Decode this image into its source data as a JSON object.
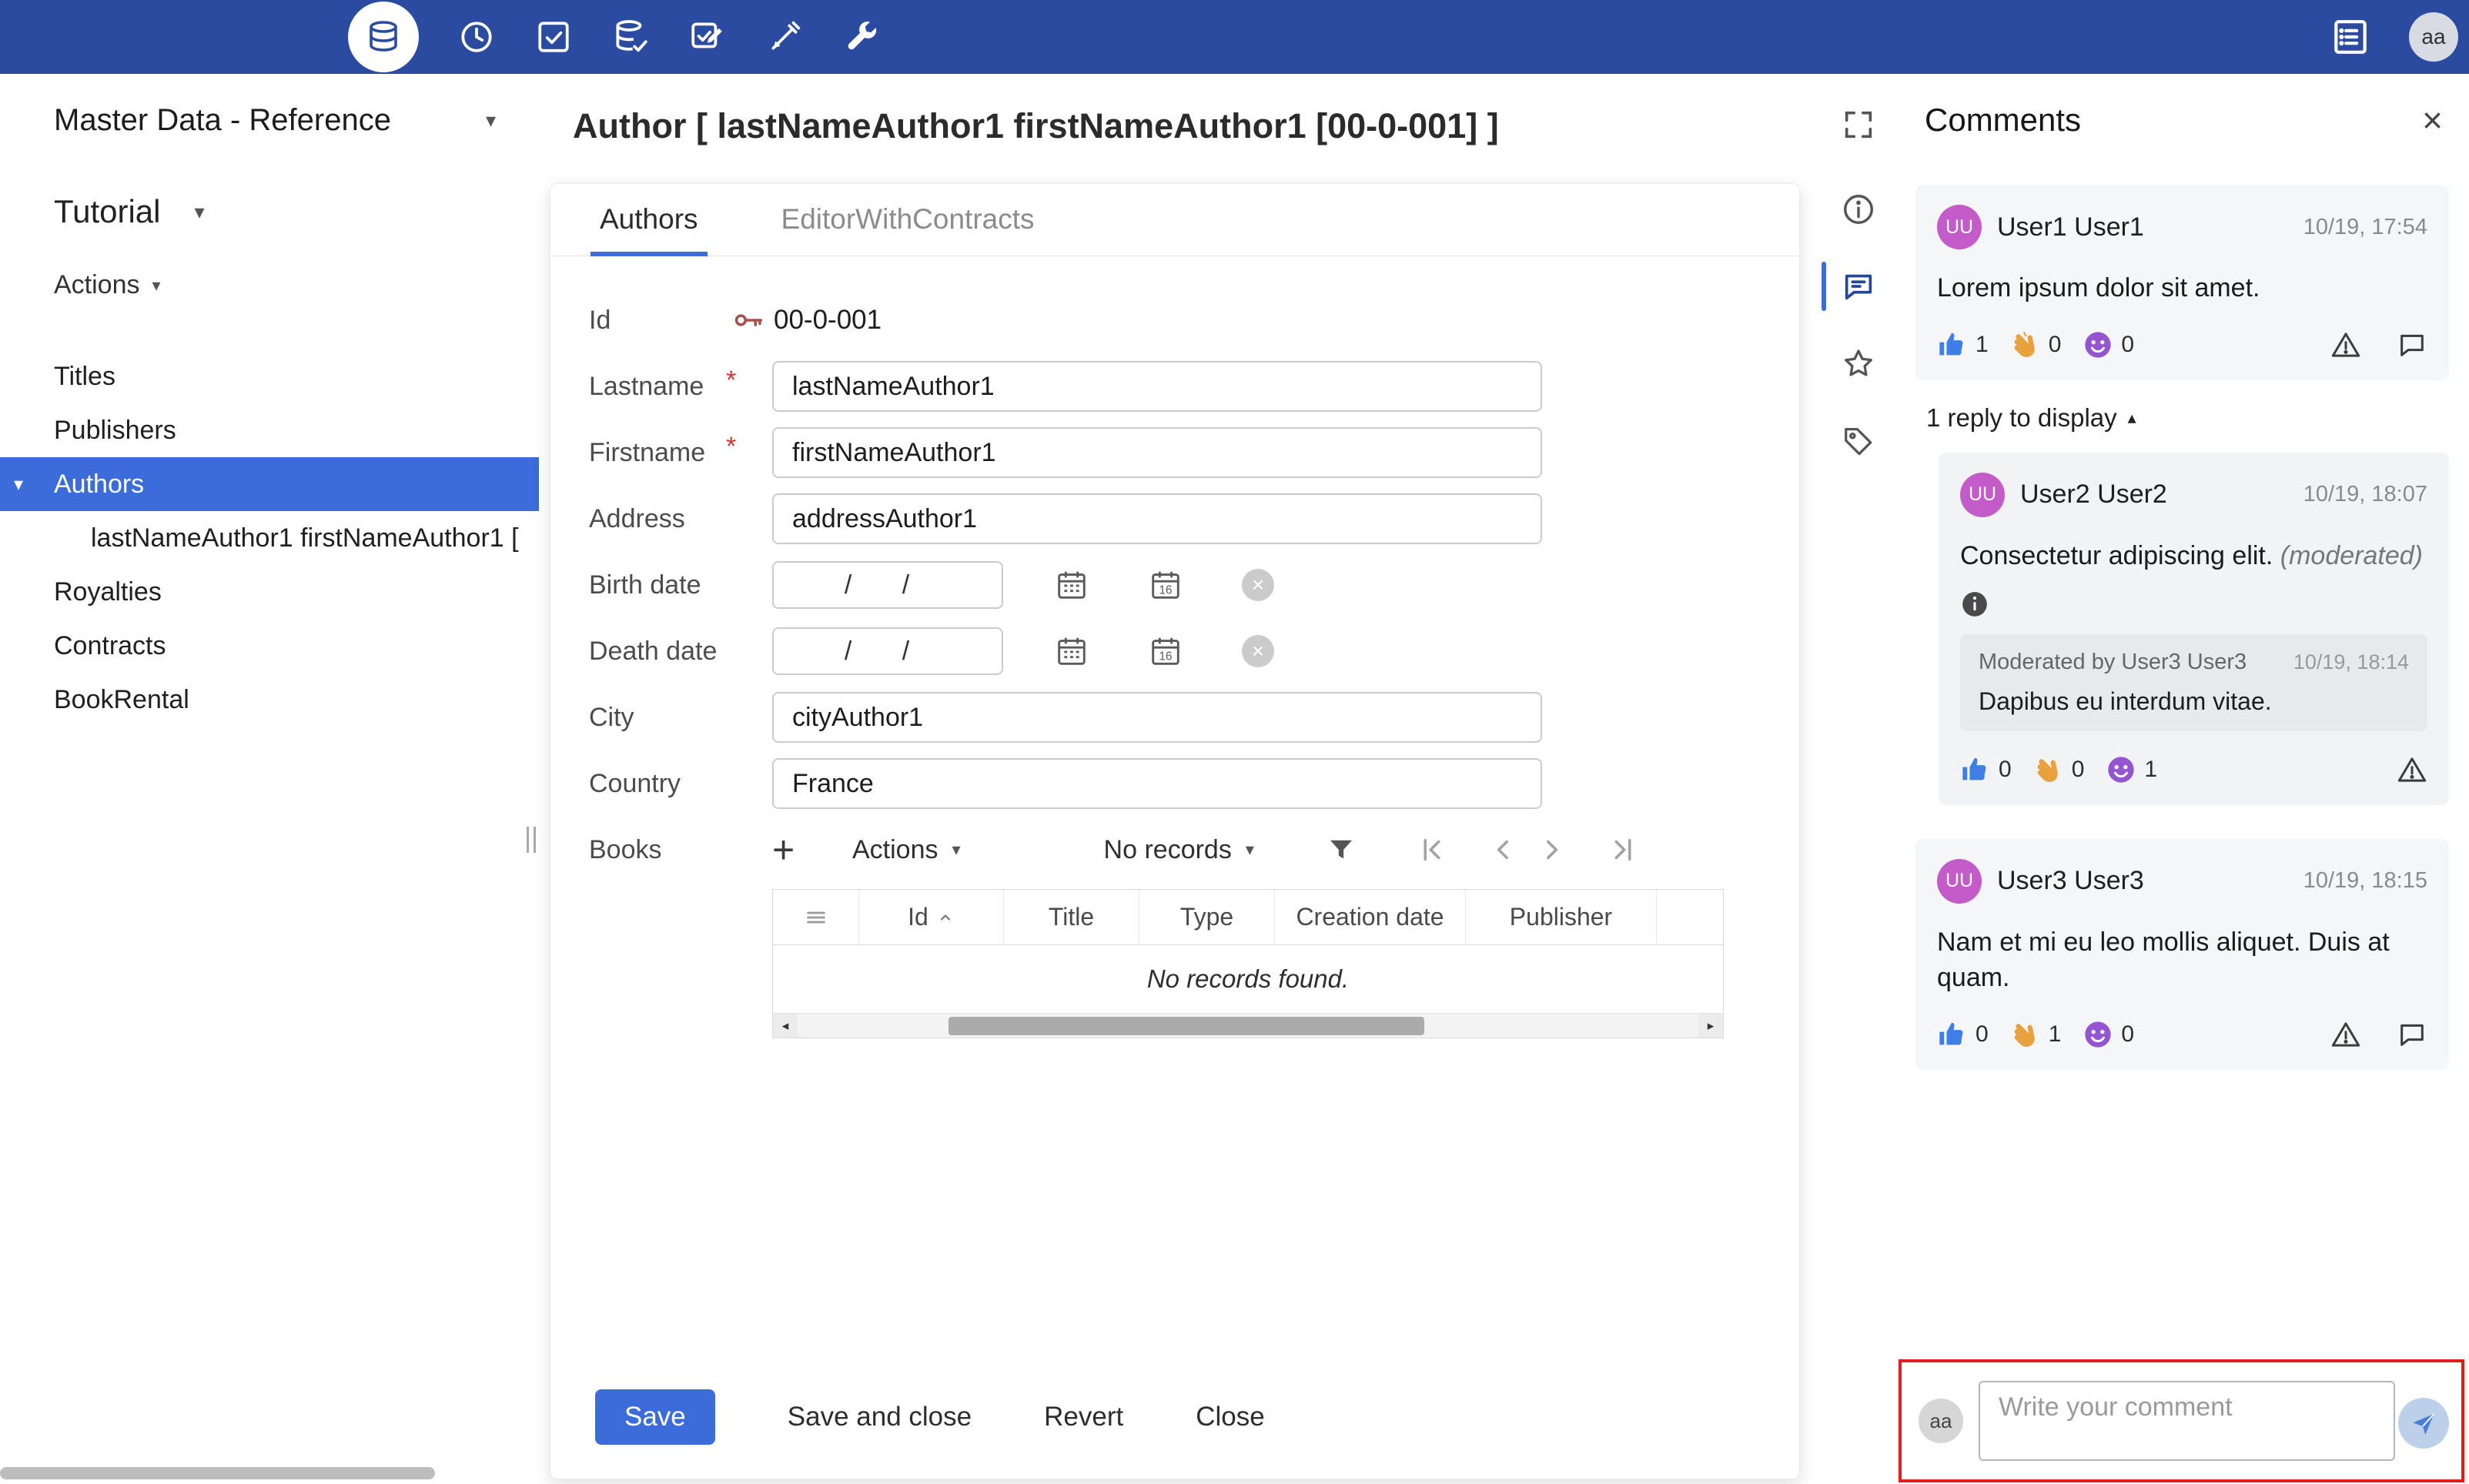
{
  "colors": {
    "topbar": "#2a4ba0",
    "accent": "#3b6cd9",
    "annotation": "#e11d1d",
    "avatar_purple": "#c35bc9"
  },
  "glyphs": {
    "caret_down": "▾",
    "caret_up": "▴",
    "close": "×",
    "plus": "+",
    "required": "*",
    "clear": "×",
    "scroll_left": "◂",
    "scroll_right": "▸"
  },
  "topbar": {
    "avatar": "aa"
  },
  "sidebar": {
    "workspace": "Master Data - Reference",
    "section": "Tutorial",
    "actions_label": "Actions",
    "items": [
      {
        "label": "Titles"
      },
      {
        "label": "Publishers"
      },
      {
        "label": "Authors"
      },
      {
        "label": "lastNameAuthor1 firstNameAuthor1 ["
      },
      {
        "label": "Royalties"
      },
      {
        "label": "Contracts"
      },
      {
        "label": "BookRental"
      }
    ]
  },
  "main": {
    "title": "Author [ lastNameAuthor1 firstNameAuthor1 [00-0-001] ]",
    "tabs": [
      {
        "label": "Authors"
      },
      {
        "label": "EditorWithContracts"
      }
    ],
    "form": {
      "id_label": "Id",
      "id_value": "00-0-001",
      "lastname_label": "Lastname",
      "lastname_value": "lastNameAuthor1",
      "firstname_label": "Firstname",
      "firstname_value": "firstNameAuthor1",
      "address_label": "Address",
      "address_value": "addressAuthor1",
      "birth_label": "Birth date",
      "birth_value": "/ /",
      "death_label": "Death date",
      "death_value": "/ /",
      "city_label": "City",
      "city_value": "cityAuthor1",
      "country_label": "Country",
      "country_value": "France",
      "books_label": "Books"
    },
    "books": {
      "actions_label": "Actions",
      "records_label": "No records",
      "columns": [
        "Id",
        "Title",
        "Type",
        "Creation date",
        "Publisher"
      ],
      "empty_message": "No records found."
    },
    "buttons": {
      "save": "Save",
      "save_close": "Save and close",
      "revert": "Revert",
      "close": "Close"
    }
  },
  "comments": {
    "title": "Comments",
    "comment1": {
      "initials": "UU",
      "author": "User1 User1",
      "time": "10/19, 17:54",
      "text": "Lorem ipsum dolor sit amet.",
      "like": "1",
      "clap": "0",
      "face": "0"
    },
    "reply_toggle": "1 reply to display",
    "reply": {
      "initials": "UU",
      "author": "User2 User2",
      "time": "10/19, 18:07",
      "text": "Consectetur adipiscing elit.",
      "moderated": "(moderated)",
      "mod_title": "Moderated by User3 User3",
      "mod_time": "10/19, 18:14",
      "mod_text": "Dapibus eu interdum vitae.",
      "like": "0",
      "clap": "0",
      "face": "1"
    },
    "comment2": {
      "initials": "UU",
      "author": "User3 User3",
      "time": "10/19, 18:15",
      "text": "Nam et mi eu leo mollis aliquet. Duis at quam.",
      "like": "0",
      "clap": "1",
      "face": "0"
    },
    "composer": {
      "avatar": "aa",
      "placeholder": "Write your comment"
    }
  }
}
